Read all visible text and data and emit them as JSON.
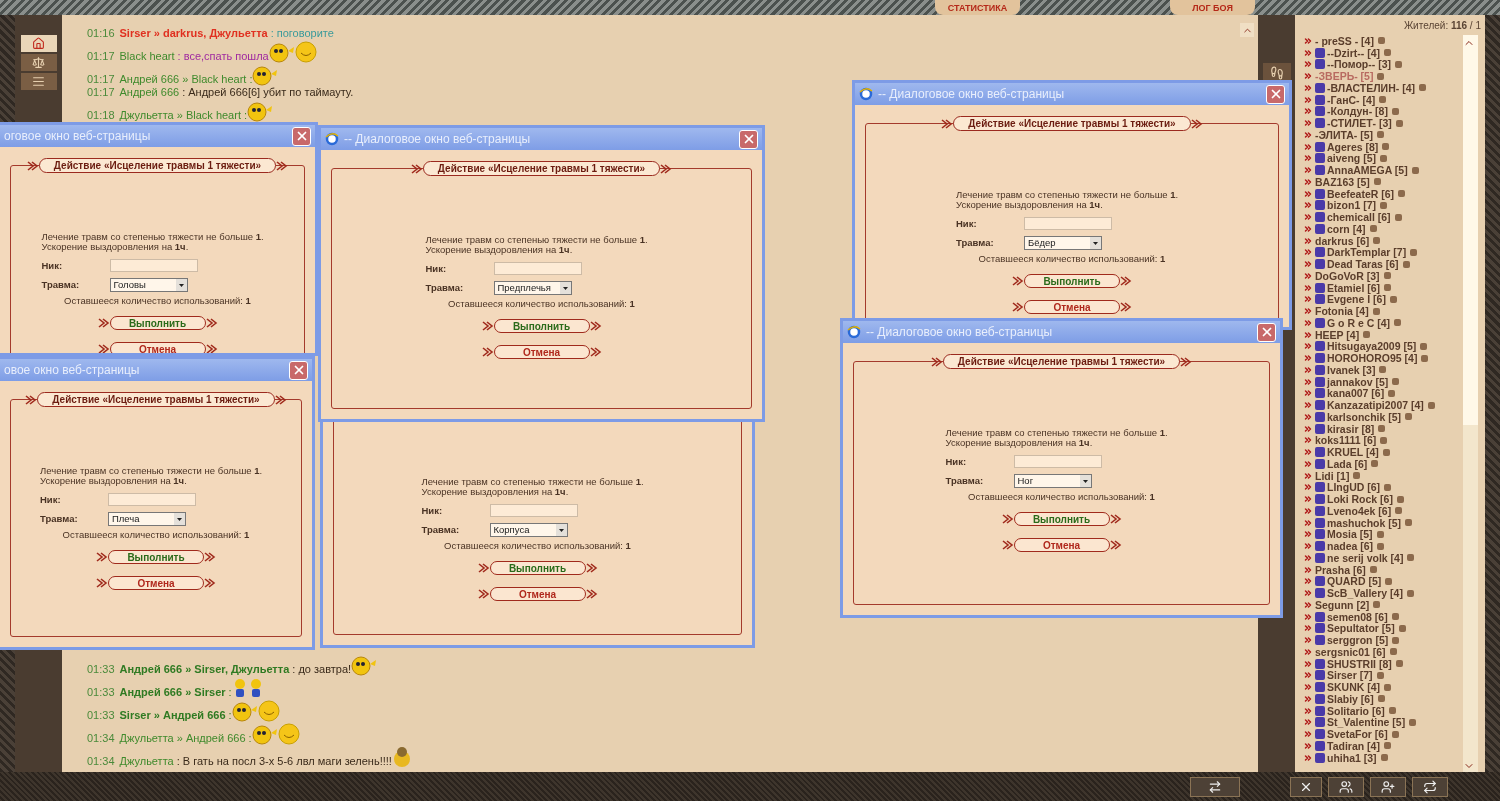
{
  "top_tabs": [
    {
      "label": "СТАТИСТИКА"
    },
    {
      "label": "ЛОГ БОЯ"
    }
  ],
  "chat": {
    "earlier": [
      {
        "time": "01:16",
        "from": "Sirser » darkrus, Джульетта",
        "bold": true,
        "color": "#e03020",
        "message": {
          "text": ": поговорите",
          "color": "#3a9a9a"
        }
      },
      {
        "time": "01:17",
        "from": "Black heart",
        "bold": false,
        "color": "#3f8a2c",
        "message": {
          "text": ": все,спать пошла",
          "color": "#a02aa0"
        },
        "emoticons": [
          {
            "kind": "smile"
          },
          {
            "kind": "laugh"
          }
        ]
      },
      {
        "time": "01:17",
        "from": "Андрей 666 » Black heart",
        "bold": false,
        "color": "#3f8a2c",
        "message": {
          "text": ":"
        },
        "emoticons": [
          {
            "kind": "smile"
          }
        ]
      },
      {
        "time": "01:17",
        "from": "Андрей 666",
        "bold": false,
        "color": "#3f8a2c",
        "message": {
          "text": ": Андрей 666[6] убит по таймауту.",
          "color": "#3a2a1a"
        }
      },
      {
        "time": "01:18",
        "from": "Джульетта » Black heart",
        "bold": false,
        "color": "#3f8a2c",
        "message": {
          "text": ":"
        },
        "emoticons": [
          {
            "kind": "smile"
          }
        ]
      }
    ],
    "latest": [
      {
        "time": "01:33",
        "from": "Андрей 666 » Sirser, Джульетта",
        "bold": true,
        "color": "#2f7a22",
        "message": {
          "text": ": до завтра!",
          "color": "#3a2a1a"
        },
        "emoticons": [
          {
            "kind": "smile"
          }
        ]
      },
      {
        "time": "01:33",
        "from": "Андрей 666 » Sirser",
        "bold": true,
        "color": "#2f7a22",
        "message": {
          "text": ":"
        },
        "emoticons": [
          {
            "kind": "figure"
          },
          {
            "kind": "figure"
          }
        ]
      },
      {
        "time": "01:33",
        "from": "Sirser » Андрей 666",
        "bold": true,
        "color": "#2f7a22",
        "message": {
          "text": ":"
        },
        "emoticons": [
          {
            "kind": "smile"
          },
          {
            "kind": "laugh"
          }
        ]
      },
      {
        "time": "01:34",
        "from": "Джульетта » Андрей 666",
        "bold": false,
        "color": "#3f8a2c",
        "message": {
          "text": ":"
        },
        "emoticons": [
          {
            "kind": "smile"
          },
          {
            "kind": "laugh"
          }
        ]
      },
      {
        "time": "01:34",
        "from": "Джульетта",
        "bold": false,
        "color": "#3f8a2c",
        "message": {
          "text": ": В гать на посл 3-х 5-6 лвл маги зелень!!!!",
          "color": "#3a2a1a"
        },
        "emoticons": [
          {
            "kind": "bear"
          }
        ]
      }
    ]
  },
  "dialogs": [
    {
      "kind": "clipped",
      "title": "оговое окно веб-страницы",
      "heading": "Действие «Исцеление травмы 1 тяжести»",
      "description": [
        "Лечение травм со степенью тяжести не больше **1**.",
        "Ускорение выздоровления на **1ч**."
      ],
      "nick_label": "Ник:",
      "injury_label": "Травма:",
      "injury": "Головы",
      "remaining": "Оставшееся количество использований: **1**",
      "buttons": [
        {
          "label": "Выполнить",
          "kind": "confirm"
        },
        {
          "label": "Отмена",
          "kind": "cancel"
        }
      ]
    },
    {
      "kind": "clipped",
      "title": "овое окно веб-страницы",
      "heading": "Действие «Исцеление травмы 1 тяжести»",
      "description": [
        "Лечение травм со степенью тяжести не больше **1**.",
        "Ускорение выздоровления на **1ч**."
      ],
      "nick_label": "Ник:",
      "injury_label": "Травма:",
      "injury": "Плеча",
      "remaining": "Оставшееся количество использований: **1**",
      "buttons": [
        {
          "label": "Выполнить",
          "kind": "confirm"
        },
        {
          "label": "Отмена",
          "kind": "cancel"
        }
      ]
    },
    {
      "kind": "full",
      "title": "-- Диалоговое окно веб-страницы",
      "heading": "Действие «Исцеление травмы 1 тяжести»",
      "description": [
        "Лечение травм со степенью тяжести не больше **1**.",
        "Ускорение выздоровления на **1ч**."
      ],
      "nick_label": "Ник:",
      "injury_label": "Травма:",
      "injury": "Предплечья",
      "remaining": "Оставшееся количество использований: **1**",
      "buttons": [
        {
          "label": "Выполнить",
          "kind": "confirm"
        },
        {
          "label": "Отмена",
          "kind": "cancel"
        }
      ]
    },
    {
      "kind": "covered",
      "description": [
        "Лечение травм со степенью тяжести не больше **1**.",
        "Ускорение выздоровления на **1ч**."
      ],
      "nick_label": "Ник:",
      "injury_label": "Травма:",
      "injury": "Корпуса",
      "remaining": "Оставшееся количество использований: **1**",
      "buttons": [
        {
          "label": "Выполнить",
          "kind": "confirm"
        },
        {
          "label": "Отмена",
          "kind": "cancel"
        }
      ]
    },
    {
      "kind": "full",
      "title": "-- Диалоговое окно веб-страницы",
      "heading": "Действие «Исцеление травмы 1 тяжести»",
      "description": [
        "Лечение травм со степенью тяжести не больше **1**.",
        "Ускорение выздоровления на **1ч**."
      ],
      "nick_label": "Ник:",
      "injury_label": "Травма:",
      "injury": "Бёдер",
      "remaining": "Оставшееся количество использований: **1**",
      "buttons": [
        {
          "label": "Выполнить",
          "kind": "confirm"
        },
        {
          "label": "Отмена",
          "kind": "cancel"
        }
      ]
    },
    {
      "kind": "full",
      "title": "-- Диалоговое окно веб-страницы",
      "heading": "Действие «Исцеление травмы 1 тяжести»",
      "description": [
        "Лечение травм со степенью тяжести не больше **1**.",
        "Ускорение выздоровления на **1ч**."
      ],
      "nick_label": "Ник:",
      "injury_label": "Травма:",
      "injury": "Ног",
      "remaining": "Оставшееся количество использований: **1**",
      "buttons": [
        {
          "label": "Выполнить",
          "kind": "confirm"
        },
        {
          "label": "Отмена",
          "kind": "cancel"
        }
      ]
    }
  ],
  "residents": {
    "count": "Жителей: **116** / 1",
    "users": [
      {
        "name": "- preSS - [4]",
        "emblem": false,
        "faded": false
      },
      {
        "name": "--Dzirt-- [4]",
        "emblem": true,
        "faded": false
      },
      {
        "name": "--Помор-- [3]",
        "emblem": true,
        "faded": false
      },
      {
        "name": "-ЗВЕРЬ- [5]",
        "emblem": false,
        "faded": true
      },
      {
        "name": "-ВЛАСТЕЛИН- [4]",
        "emblem": true,
        "faded": false
      },
      {
        "name": "-ГанС- [4]",
        "emblem": true,
        "faded": false
      },
      {
        "name": "-Колдун- [8]",
        "emblem": true,
        "faded": false
      },
      {
        "name": "-СТИЛЕТ- [3]",
        "emblem": true,
        "faded": false
      },
      {
        "name": "-ЭЛИТА- [5]",
        "emblem": false,
        "faded": false
      },
      {
        "name": "Ageres [8]",
        "emblem": true,
        "faded": false
      },
      {
        "name": "aiveng [5]",
        "emblem": true,
        "faded": false
      },
      {
        "name": "AnnaAMEGA [5]",
        "emblem": true,
        "faded": false
      },
      {
        "name": "BAZ163 [5]",
        "emblem": false,
        "faded": false
      },
      {
        "name": "BeefeateR [6]",
        "emblem": true,
        "faded": false
      },
      {
        "name": "bizon1 [7]",
        "emblem": true,
        "faded": false
      },
      {
        "name": "chemicall [6]",
        "emblem": true,
        "faded": false
      },
      {
        "name": "corn [4]",
        "emblem": true,
        "faded": false
      },
      {
        "name": "darkrus [6]",
        "emblem": false,
        "faded": false
      },
      {
        "name": "DarkTemplar [7]",
        "emblem": true,
        "faded": false
      },
      {
        "name": "Dead Taras [6]",
        "emblem": true,
        "faded": false
      },
      {
        "name": "DoGoVoR [3]",
        "emblem": false,
        "faded": false
      },
      {
        "name": "Etamiel [6]",
        "emblem": true,
        "faded": false
      },
      {
        "name": "Evgene I [6]",
        "emblem": true,
        "faded": false
      },
      {
        "name": "Fotonia [4]",
        "emblem": false,
        "faded": false
      },
      {
        "name": "G o R e C [4]",
        "emblem": true,
        "faded": false
      },
      {
        "name": "HEEP [4]",
        "emblem": false,
        "faded": false
      },
      {
        "name": "Hitsugaya2009 [5]",
        "emblem": true,
        "faded": false
      },
      {
        "name": "HOROHORO95 [4]",
        "emblem": true,
        "faded": false
      },
      {
        "name": "Ivanek [3]",
        "emblem": true,
        "faded": false
      },
      {
        "name": "jannakov [5]",
        "emblem": true,
        "faded": false
      },
      {
        "name": "kana007 [6]",
        "emblem": true,
        "faded": false
      },
      {
        "name": "Kanzazatipi2007 [4]",
        "emblem": true,
        "faded": false
      },
      {
        "name": "karlsonchik [5]",
        "emblem": true,
        "faded": false
      },
      {
        "name": "kirasir [8]",
        "emblem": true,
        "faded": false
      },
      {
        "name": "koks1111 [6]",
        "emblem": false,
        "faded": false
      },
      {
        "name": "KRUEL [4]",
        "emblem": true,
        "faded": false
      },
      {
        "name": "Lada [6]",
        "emblem": true,
        "faded": false
      },
      {
        "name": "Lidi [1]",
        "emblem": false,
        "faded": false
      },
      {
        "name": "LIngUD [6]",
        "emblem": true,
        "faded": false
      },
      {
        "name": "Loki Rock [6]",
        "emblem": true,
        "faded": false
      },
      {
        "name": "Lveno4ek [6]",
        "emblem": true,
        "faded": false
      },
      {
        "name": "mashuchok [5]",
        "emblem": true,
        "faded": false
      },
      {
        "name": "Mosia [5]",
        "emblem": true,
        "faded": false
      },
      {
        "name": "nadea [6]",
        "emblem": true,
        "faded": false
      },
      {
        "name": "ne serij volk [4]",
        "emblem": true,
        "faded": false
      },
      {
        "name": "Prasha [6]",
        "emblem": false,
        "faded": false
      },
      {
        "name": "QUARD [5]",
        "emblem": true,
        "faded": false
      },
      {
        "name": "ScB_Vallery [4]",
        "emblem": true,
        "faded": false
      },
      {
        "name": "Segunn [2]",
        "emblem": false,
        "faded": false
      },
      {
        "name": "semen08 [6]",
        "emblem": true,
        "faded": false
      },
      {
        "name": "Sepultator [5]",
        "emblem": true,
        "faded": false
      },
      {
        "name": "serggron [5]",
        "emblem": true,
        "faded": false
      },
      {
        "name": "sergsnic01 [6]",
        "emblem": false,
        "faded": false
      },
      {
        "name": "SHUSTRII [8]",
        "emblem": true,
        "faded": false
      },
      {
        "name": "Sirser [7]",
        "emblem": true,
        "faded": false
      },
      {
        "name": "SKUNK [4]",
        "emblem": true,
        "faded": false
      },
      {
        "name": "Slabiy [6]",
        "emblem": true,
        "faded": false
      },
      {
        "name": "Solitario [6]",
        "emblem": true,
        "faded": false
      },
      {
        "name": "St_Valentine [5]",
        "emblem": true,
        "faded": false
      },
      {
        "name": "SvetaFor [6]",
        "emblem": true,
        "faded": false
      },
      {
        "name": "Tadiran [4]",
        "emblem": true,
        "faded": false
      },
      {
        "name": "uhiha1 [3]",
        "emblem": true,
        "faded": false
      }
    ]
  }
}
